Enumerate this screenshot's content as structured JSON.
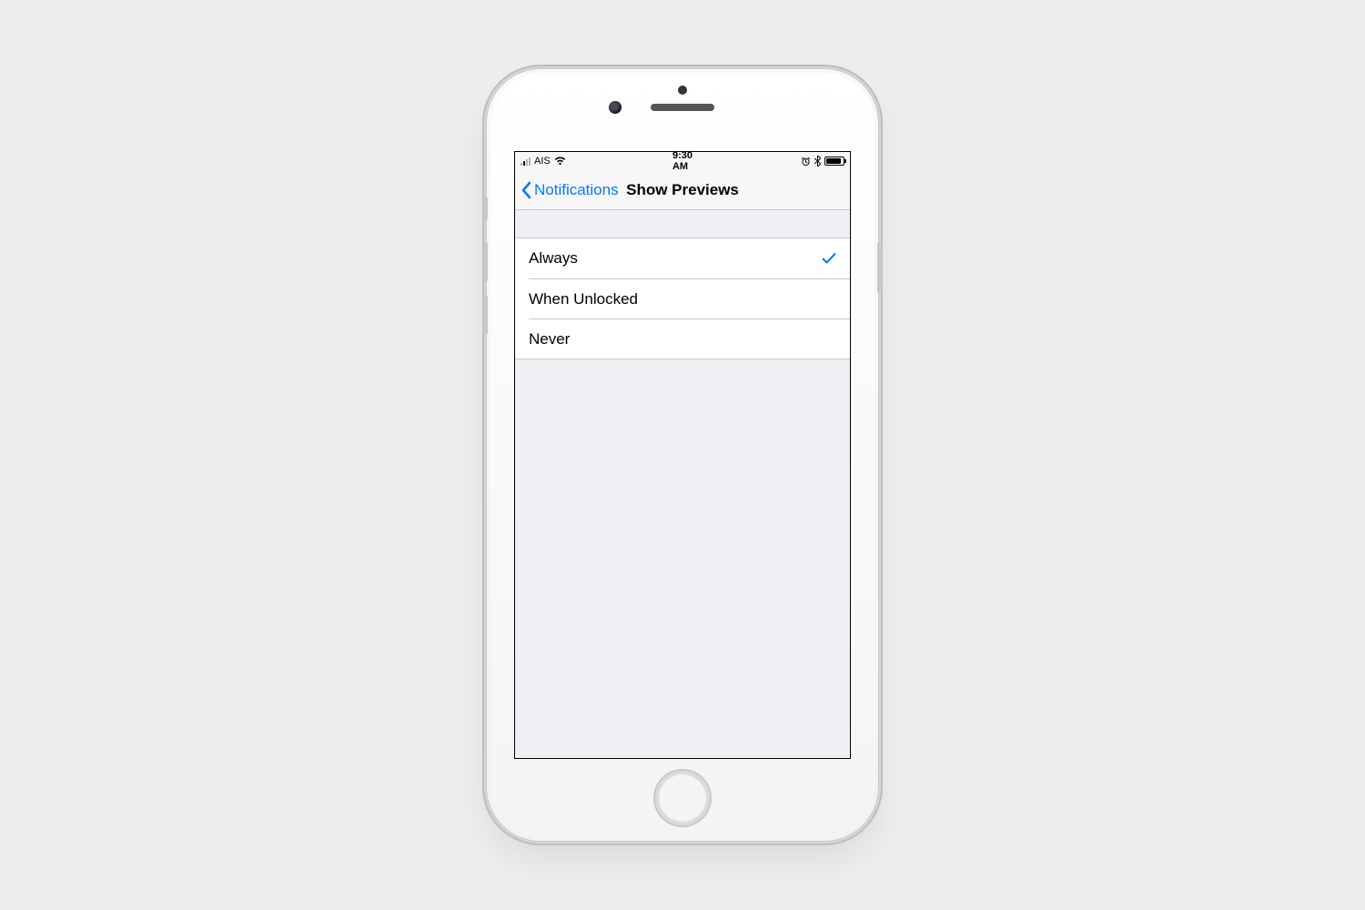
{
  "statusbar": {
    "carrier": "AIS",
    "time": "9:30 AM"
  },
  "navbar": {
    "back_label": "Notifications",
    "title": "Show Previews"
  },
  "options": [
    {
      "label": "Always",
      "selected": true
    },
    {
      "label": "When Unlocked",
      "selected": false
    },
    {
      "label": "Never",
      "selected": false
    }
  ],
  "colors": {
    "tint": "#007aff",
    "bg": "#efeff4"
  }
}
